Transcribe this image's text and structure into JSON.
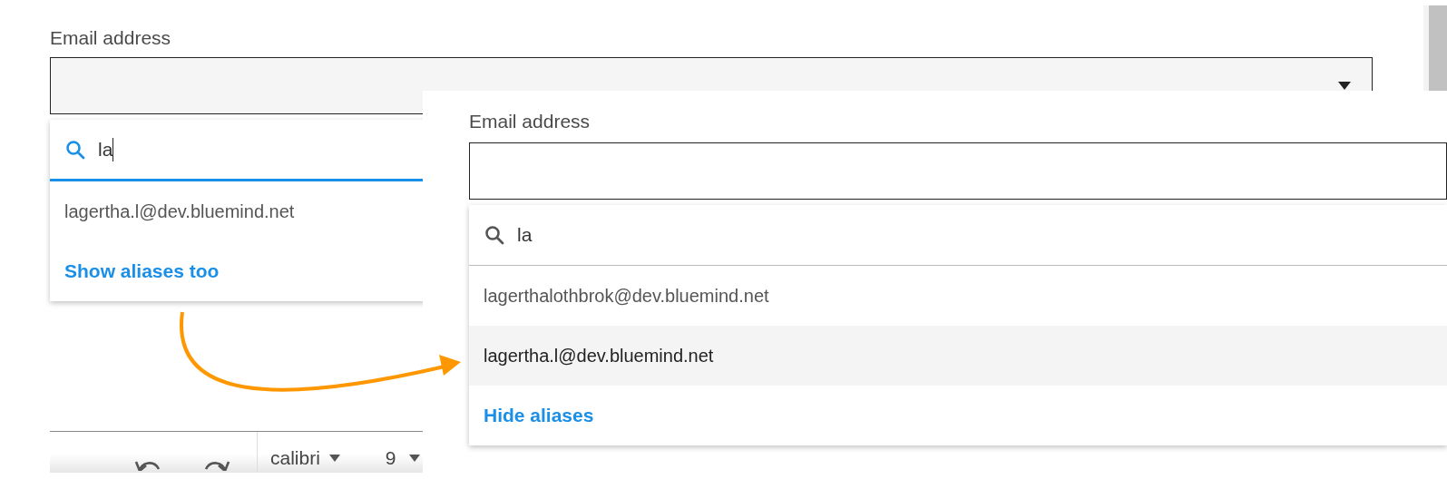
{
  "panels": [
    {
      "kind": "background",
      "field_label": "Email address",
      "search": "la",
      "focused": true,
      "options": [
        {
          "text": "lagertha.l@dev.bluemind.net",
          "selected": false
        }
      ],
      "toggle_link": "Show aliases too",
      "toolbar": {
        "font": "calibri",
        "size": "9"
      }
    },
    {
      "kind": "overlay",
      "field_label": "Email address",
      "search": "la",
      "focused": false,
      "options": [
        {
          "text": "lagerthalothbrok@dev.bluemind.net",
          "selected": false
        },
        {
          "text": "lagertha.l@dev.bluemind.net",
          "selected": true
        }
      ],
      "toggle_link": "Hide aliases"
    }
  ]
}
